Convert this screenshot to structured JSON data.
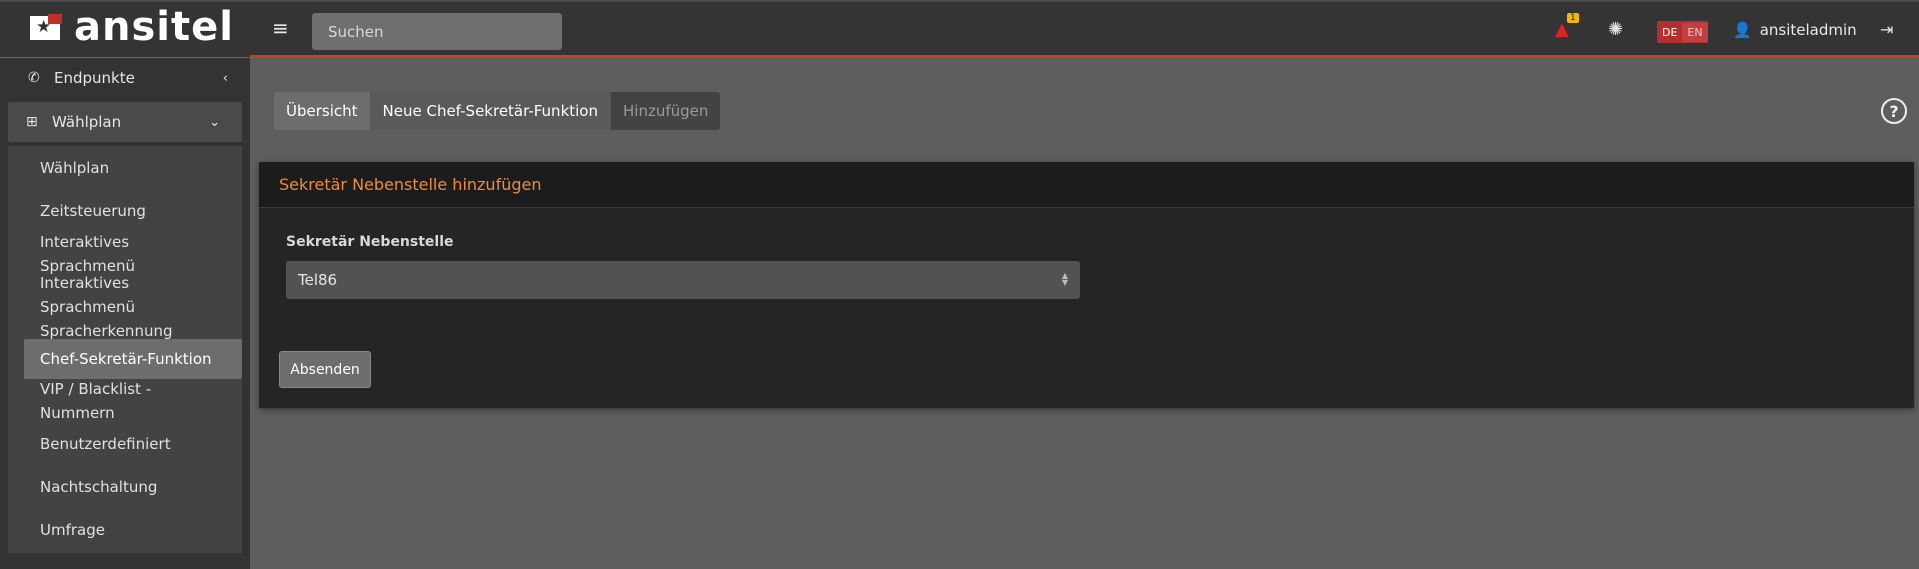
{
  "brand": {
    "name": "ansitel"
  },
  "topbar": {
    "search_placeholder": "Suchen",
    "warning_count": "1",
    "lang_de": "DE",
    "lang_en": "EN",
    "username": "ansiteladmin"
  },
  "sidebar": {
    "endpoints_label": "Endpunkte",
    "dialplan_label": "Wählplan",
    "subitems": [
      "Wählplan",
      "Zeitsteuerung",
      "Interaktives Sprachmenü",
      "Interaktives Sprachmenü Spracherkennung",
      "Chef-Sekretär-Funktion",
      "VIP / Blacklist - Nummern",
      "Benutzerdefiniert",
      "Nachtschaltung",
      "Umfrage"
    ]
  },
  "breadcrumb": {
    "items": [
      "Übersicht",
      "Neue Chef-Sekretär-Funktion",
      "Hinzufügen"
    ]
  },
  "panel": {
    "title": "Sekretär Nebenstelle hinzufügen",
    "field_label": "Sekretär Nebenstelle",
    "select_value": "Tel86",
    "submit_label": "Absenden"
  },
  "colors": {
    "accent": "#c0442a",
    "panel_title": "#f08a3a"
  }
}
